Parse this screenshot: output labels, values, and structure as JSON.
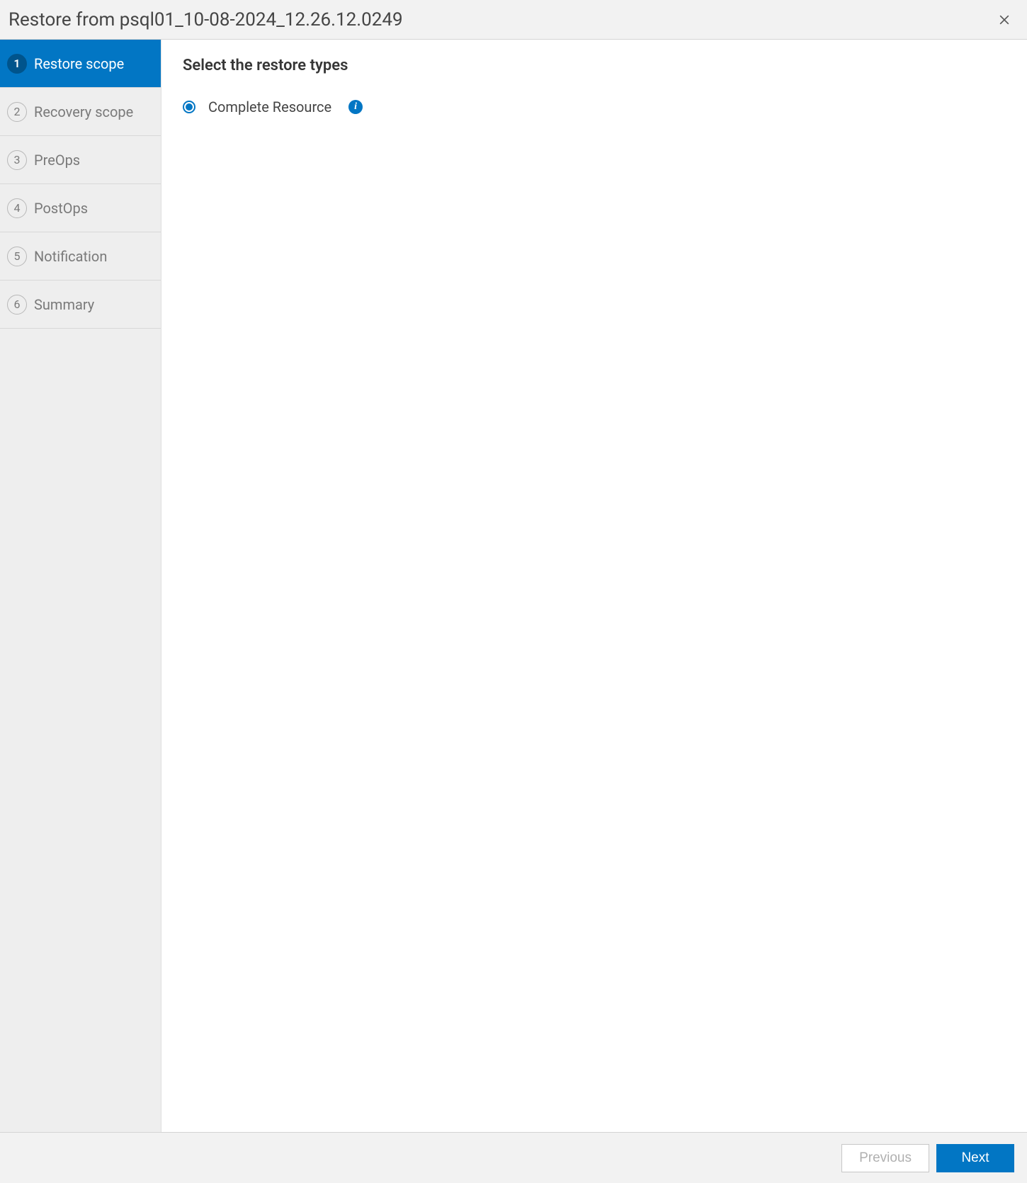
{
  "header": {
    "title": "Restore from psql01_10-08-2024_12.26.12.0249"
  },
  "sidebar": {
    "steps": [
      {
        "num": "1",
        "label": "Restore scope"
      },
      {
        "num": "2",
        "label": "Recovery scope"
      },
      {
        "num": "3",
        "label": "PreOps"
      },
      {
        "num": "4",
        "label": "PostOps"
      },
      {
        "num": "5",
        "label": "Notification"
      },
      {
        "num": "6",
        "label": "Summary"
      }
    ],
    "active_index": 0
  },
  "content": {
    "title": "Select the restore types",
    "option_complete_resource": "Complete Resource"
  },
  "footer": {
    "previous": "Previous",
    "next": "Next"
  }
}
